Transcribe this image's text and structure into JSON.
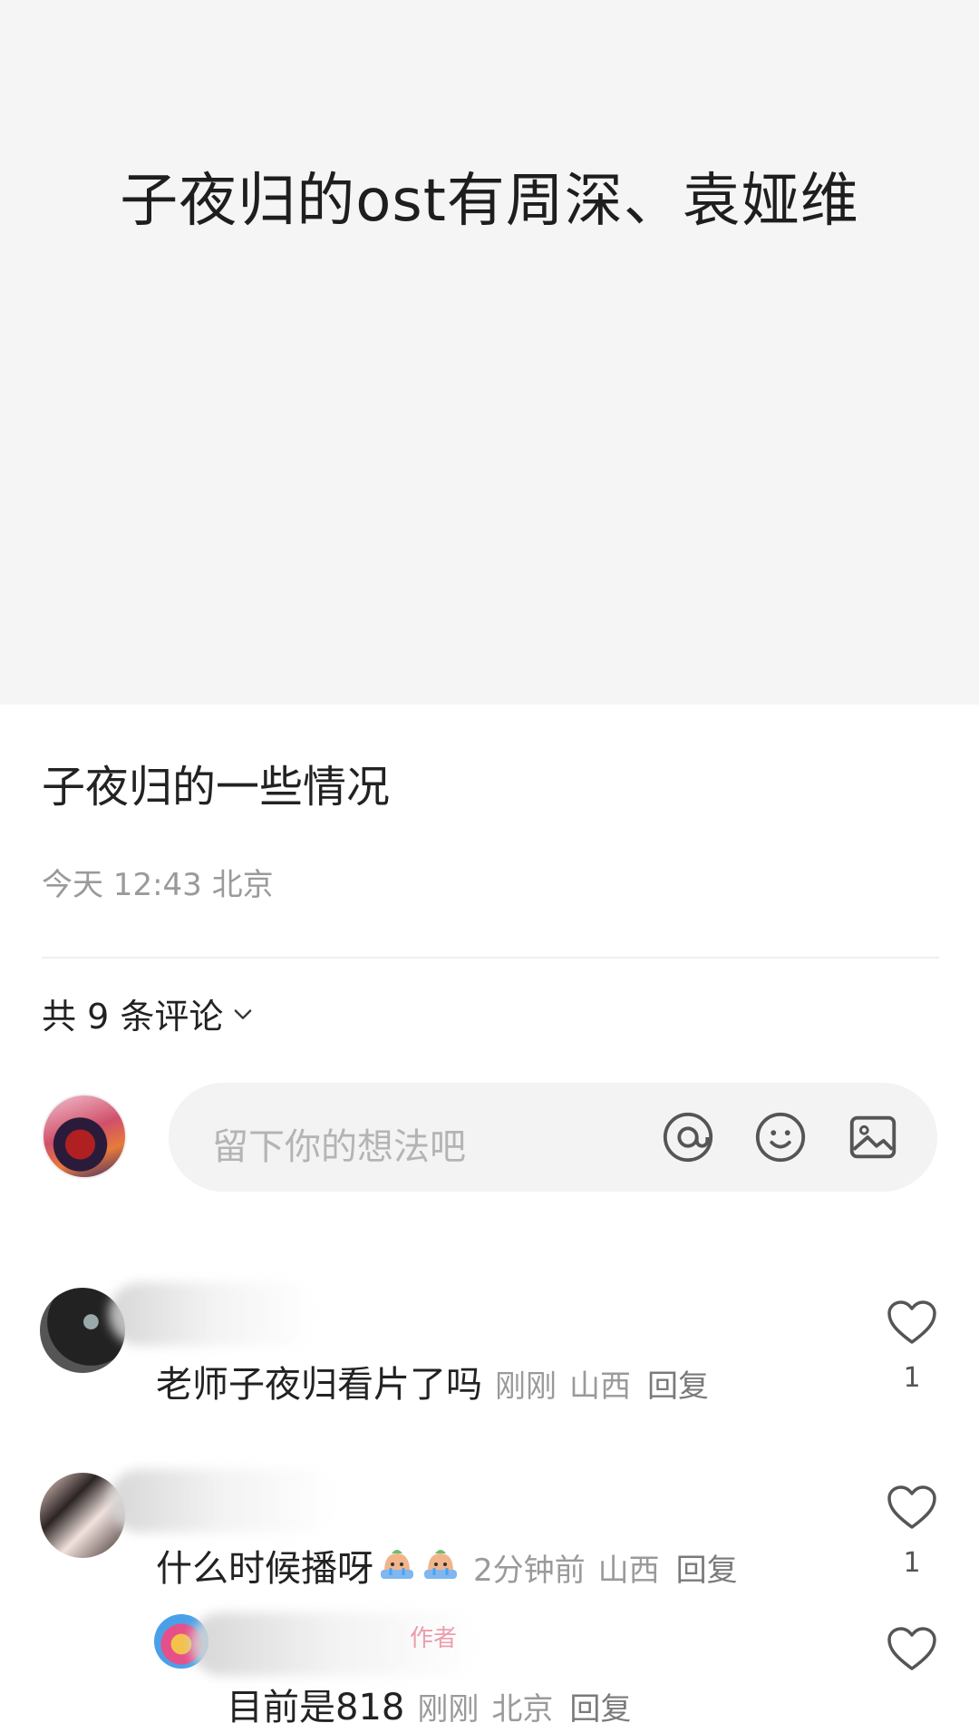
{
  "cover": {
    "text": "子夜归的ost有周深、袁娅维"
  },
  "post": {
    "title": "子夜归的一些情况",
    "meta": "今天 12:43 北京"
  },
  "comments_header": {
    "label": "共 9 条评论"
  },
  "input": {
    "placeholder": "留下你的想法吧"
  },
  "comments": [
    {
      "text": "老师子夜归看片了吗",
      "time": "刚刚",
      "location": "山西",
      "reply": "回复",
      "likes": "1"
    },
    {
      "text": "什么时候播呀",
      "emoji_icons": [
        "crying-face-icon",
        "crying-face-icon"
      ],
      "time": "2分钟前",
      "location": "山西",
      "reply": "回复",
      "likes": "1"
    },
    {
      "text": "目前是818",
      "time": "刚刚",
      "location": "北京",
      "reply": "回复",
      "author_badge": "作者"
    }
  ],
  "colors": {
    "cover_bg": "#f5f5f5",
    "meta": "#9a9a9a",
    "heart_stroke": "#555555"
  }
}
